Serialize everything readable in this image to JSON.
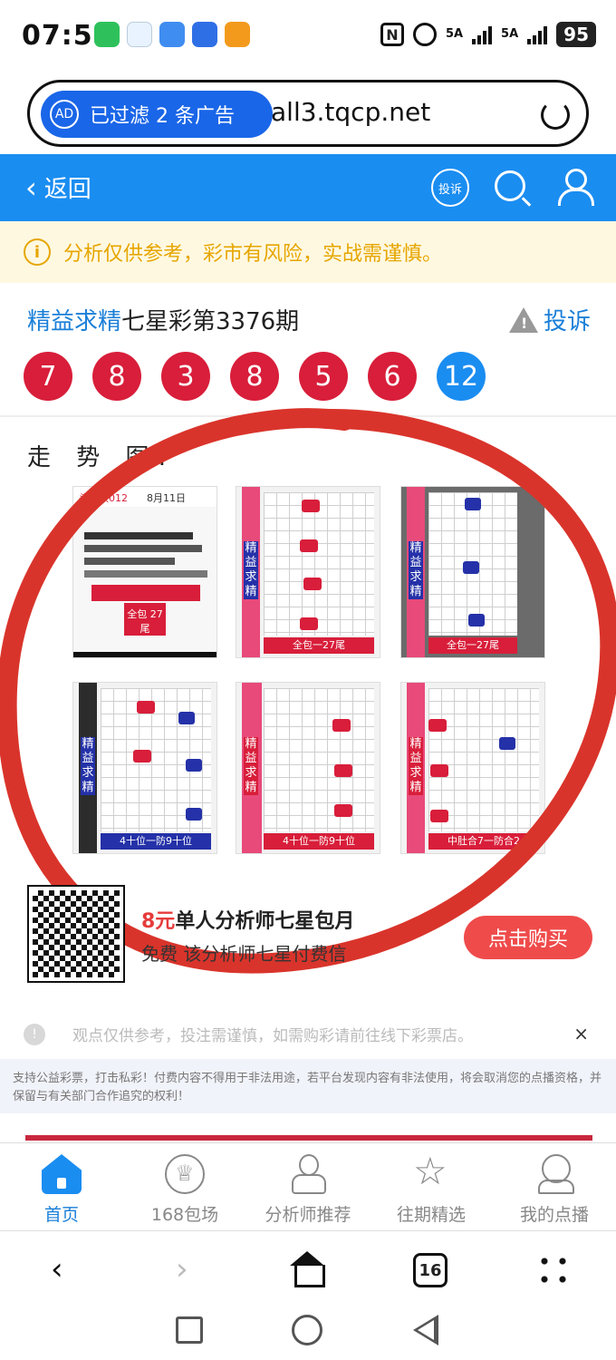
{
  "status_bar": {
    "time": "07:51",
    "signal1": "5A",
    "signal2": "5A",
    "battery": "95",
    "nfc": "N"
  },
  "url_bar": {
    "ad_badge": "AD",
    "ad_filter_text": "已过滤 2 条广告",
    "url": "all3.tqcp.net"
  },
  "header": {
    "back_label": "返回",
    "complain_icon_label": "投诉"
  },
  "notice": {
    "icon": "i",
    "text": "分析仅供参考，彩市有风险，实战需谨慎。"
  },
  "article": {
    "title_highlight": "精益求精",
    "title_rest": "七星彩第3376期",
    "report_label": "投诉"
  },
  "balls": [
    "7",
    "8",
    "3",
    "8",
    "5",
    "6",
    "12"
  ],
  "trend": {
    "label": "走 势 图:",
    "thumbnails": [
      {
        "caption": "全包 27尾",
        "header": "头尾数012",
        "date": "8月11日"
      },
      {
        "caption": "全包一27尾"
      },
      {
        "caption": "全包一27尾"
      },
      {
        "caption": "4十位一防9十位"
      },
      {
        "caption": "4十位一防9十位"
      },
      {
        "caption": "中肚合7一防合2"
      }
    ]
  },
  "thumb_side_text": "精益求精",
  "promo": {
    "price": "8元",
    "title": "单人分析师七星包月",
    "subtitle": "免费 该分析师七星付费信",
    "buy_label": "点击购买"
  },
  "disclaimer": {
    "line1": "观点仅供参考，投注需谨慎，如需购彩请前往线下彩票店。",
    "close": "×",
    "line2": "支持公益彩票，打击私彩！付费内容不得用于非法用途，若平台发现内容有非法使用，将会取消您的点播资格，并保留与有关部门合作追究的权利！"
  },
  "tabs": [
    {
      "label": "首页",
      "icon": "home-icon"
    },
    {
      "label": "168包场",
      "icon": "crown-icon"
    },
    {
      "label": "分析师推荐",
      "icon": "analyst-icon"
    },
    {
      "label": "往期精选",
      "icon": "star-icon"
    },
    {
      "label": "我的点播",
      "icon": "user-icon"
    }
  ],
  "browser_nav": {
    "back": "‹",
    "forward": "›",
    "tab_count": "16"
  },
  "colors": {
    "brand_blue": "#1a8df1",
    "ball_red": "#d81e3a",
    "scribble_red": "#d9342b",
    "notice_text": "#e6a600"
  }
}
